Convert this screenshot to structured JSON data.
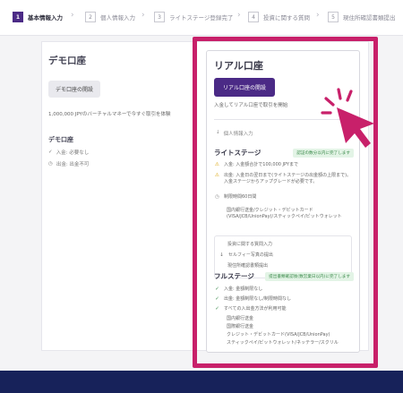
{
  "steps": [
    {
      "num": "1",
      "label": "基本情報入力",
      "active": true
    },
    {
      "num": "2",
      "label": "個人情報入力",
      "active": false
    },
    {
      "num": "3",
      "label": "ライトステージ登録完了",
      "active": false
    },
    {
      "num": "4",
      "label": "投資に関する質問",
      "active": false
    },
    {
      "num": "5",
      "label": "現住所確認書類提出",
      "active": false
    }
  ],
  "demo": {
    "title": "デモ口座",
    "button": "デモ口座の開設",
    "desc": "1,000,000 JPYのバーチャルマネーで今すぐ取引を体験",
    "sub_title": "デモ口座",
    "items": [
      "入金: 必要なし",
      "出金: 出金不可"
    ]
  },
  "real": {
    "title": "リアル口座",
    "button": "リアル口座の開設",
    "desc": "入金してリアル口座で取引を開始",
    "personal_info": "個人情報入力",
    "light": {
      "name": "ライトステージ",
      "badge": "認証の数分以内に完了します",
      "items": [
        "入金: 入金額合計で100,000 JPYまで",
        "出金: 入金日の翌日まで(ライトステージの出金額の上限まで)。入金ステージからアップグレードが必要です。",
        "制限時間60日間",
        "国内銀行送金/クレジット・デビットカード(VISA/JCB/UnionPay)/スティックペイ/ビットウォレット"
      ]
    },
    "box_items": [
      "投資に関する質問入力",
      "セルフィー写真の提出",
      "現住所確認書類提出"
    ],
    "full": {
      "name": "フルステージ",
      "badge": "提出書類確認後(数営業日以内)に完了します",
      "items": [
        "入金: 金額制限なし",
        "出金: 金額制限なし/制限時間なし",
        "すべての入出金方法が利用可能",
        "国内銀行送金",
        "国際銀行送金",
        "クレジット・デビットカード(VISA/JCB/UnionPay)",
        "スティックペイ/ビットウォレット/ネッテラー/スクリル"
      ]
    }
  },
  "colors": {
    "accent": "#4b2a86",
    "highlight": "#c8206a",
    "footer": "#17225a",
    "badge_green": "#3a8a4a"
  }
}
